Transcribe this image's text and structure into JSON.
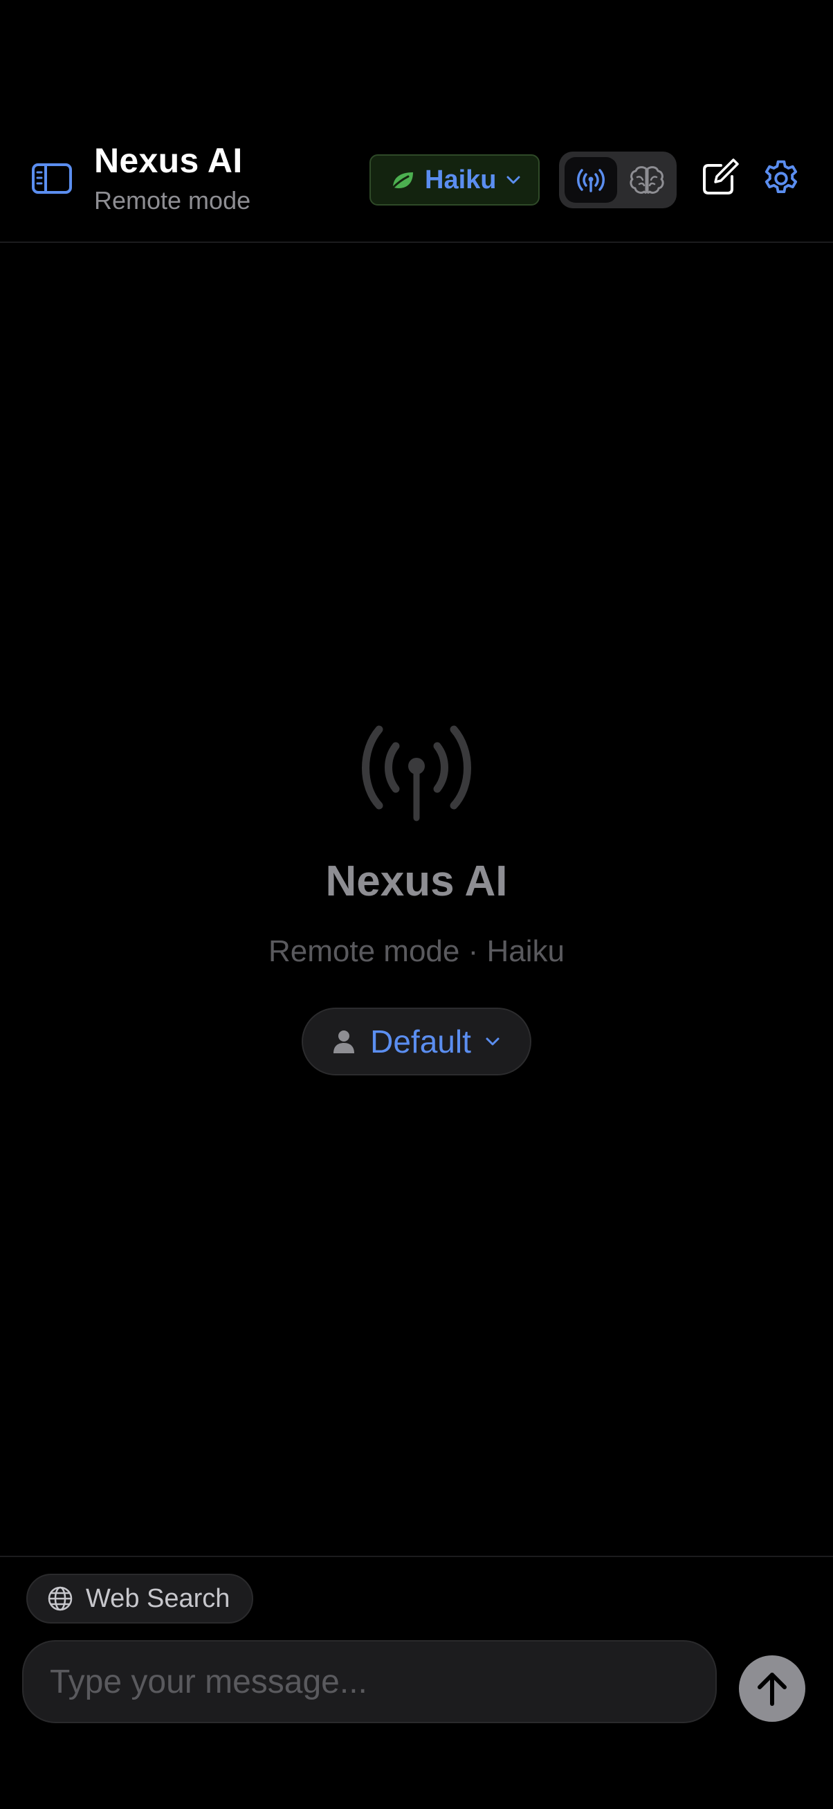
{
  "header": {
    "title": "Nexus AI",
    "subtitle": "Remote mode",
    "model_label": "Haiku",
    "icons": [
      "sidebar-icon",
      "leaf-icon",
      "chevron-down-icon",
      "antenna-icon",
      "brain-icon",
      "compose-icon",
      "gear-icon"
    ]
  },
  "empty_state": {
    "title": "Nexus AI",
    "subtitle": "Remote mode · Haiku",
    "persona_label": "Default",
    "icons": [
      "antenna-icon",
      "person-icon",
      "chevron-down-icon"
    ]
  },
  "composer": {
    "web_search_label": "Web Search",
    "placeholder": "Type your message...",
    "icons": [
      "globe-icon",
      "arrow-up-icon"
    ]
  },
  "colors": {
    "accent": "#5b8ef0",
    "leaf_green": "#4caf50",
    "background": "#000000",
    "muted": "#8e8e93"
  }
}
